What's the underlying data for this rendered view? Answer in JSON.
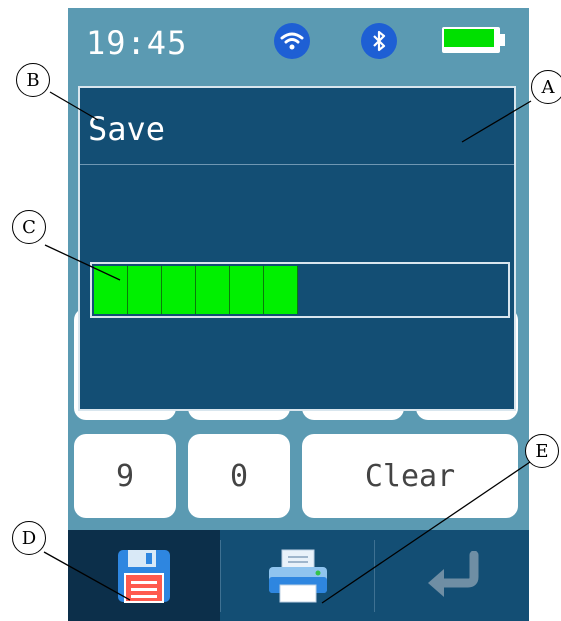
{
  "status": {
    "time": "19:45",
    "icons": [
      "wifi-icon",
      "bluetooth-icon",
      "battery-icon"
    ],
    "battery_level": 1.0
  },
  "keypad": {
    "visible_keys": [
      "9",
      "0",
      "Clear"
    ]
  },
  "dialog": {
    "title": "Save",
    "progress": {
      "segments_filled": 6,
      "fraction": 0.5
    }
  },
  "toolbar": {
    "items": [
      "save-icon",
      "printer-icon",
      "enter-icon"
    ],
    "active": "save-icon"
  },
  "callouts": [
    "A",
    "B",
    "C",
    "D",
    "E"
  ],
  "colors": {
    "background": "#5b9ab2",
    "dialog": "#134e74",
    "progress_fill": "#00f000",
    "accent_blue": "#1e5fd4",
    "battery": "#00e000"
  }
}
